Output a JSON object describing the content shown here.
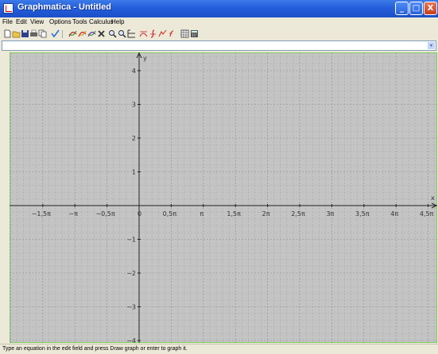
{
  "window": {
    "title": "Graphmatica - Untitled",
    "minimize_glyph": "_",
    "maximize_glyph": "□",
    "close_glyph": "X"
  },
  "menu": [
    "File",
    "Edit",
    "View",
    "Options",
    "Tools",
    "Calculus",
    "Help"
  ],
  "toolbar": {
    "icons": [
      "new-file-icon",
      "open-folder-icon",
      "save-icon",
      "print-icon",
      "copy-icon",
      "check-icon",
      "draw-graph-icon",
      "redraw-icon",
      "multi-graph-icon",
      "delete-graph-icon",
      "zoom-in-icon",
      "zoom-out-icon",
      "grid-range-icon",
      "tangent-icon",
      "integral-icon",
      "derivative-icon",
      "function-icon",
      "table-icon",
      "calculator-icon"
    ]
  },
  "equation_input": {
    "value": "",
    "dropdown_glyph": "▾"
  },
  "graph": {
    "background": "#c4c4c4",
    "axis_labels": {
      "x": "x",
      "y": "y"
    },
    "x_ticks": [
      "−1,5π",
      "−π",
      "−0,5π",
      "0",
      "0,5π",
      "π",
      "1,5π",
      "2π",
      "2,5π",
      "3π",
      "3,5π",
      "4π",
      "4,5π"
    ],
    "y_ticks": [
      "4",
      "3",
      "2",
      "1",
      "−1",
      "−2",
      "−3",
      "−4"
    ]
  },
  "status": "Type an equation in the edit field and press Draw graph or enter to graph it."
}
